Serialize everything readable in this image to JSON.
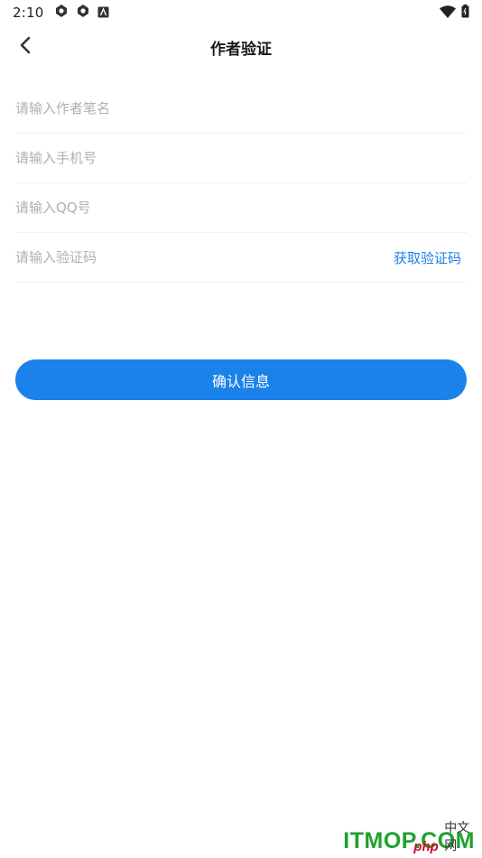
{
  "status_bar": {
    "time": "2:10",
    "icons_left": [
      "app-notification-icon",
      "app-notification-icon",
      "accessibility-icon"
    ],
    "icons_right": [
      "wifi-icon",
      "battery-icon"
    ]
  },
  "header": {
    "title": "作者验证",
    "back_icon": "chevron-left-icon"
  },
  "form": {
    "pen_name": {
      "value": "",
      "placeholder": "请输入作者笔名"
    },
    "phone": {
      "value": "",
      "placeholder": "请输入手机号"
    },
    "qq": {
      "value": "",
      "placeholder": "请输入QQ号"
    },
    "code": {
      "value": "",
      "placeholder": "请输入验证码"
    },
    "get_code_label": "获取验证码"
  },
  "confirm_label": "确认信息",
  "watermark": {
    "main": "ITMOP.COM",
    "php": "php",
    "cn": "中文网"
  },
  "colors": {
    "accent": "#1a82ea",
    "link": "#1e7fe8",
    "placeholder": "#b0b0b0"
  }
}
